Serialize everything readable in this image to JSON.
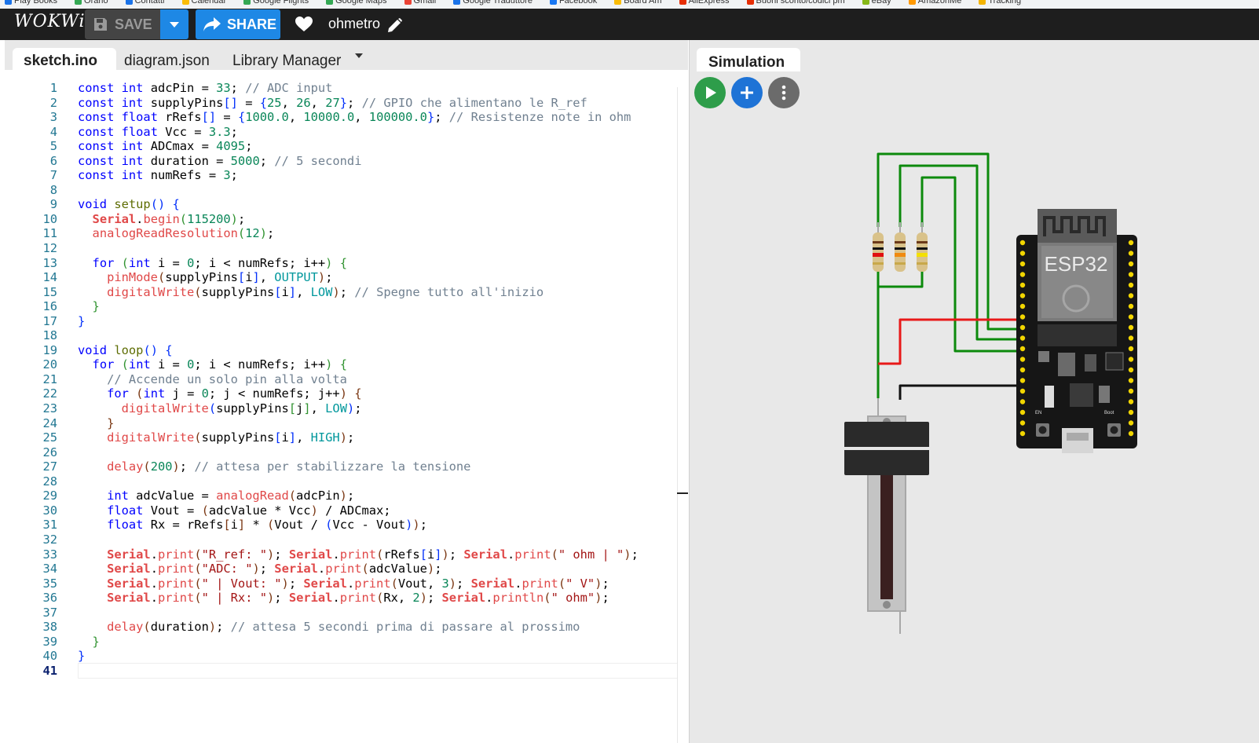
{
  "bookmarks": [
    {
      "label": "Play Books",
      "color": "#1a73e8"
    },
    {
      "label": "Orario",
      "color": "#34a853"
    },
    {
      "label": "Contatti",
      "color": "#1a73e8"
    },
    {
      "label": "Calendar",
      "color": "#fbbc04"
    },
    {
      "label": "Google Flights",
      "color": "#34a853"
    },
    {
      "label": "Google Maps",
      "color": "#34a853"
    },
    {
      "label": "Gmail",
      "color": "#ea4335"
    },
    {
      "label": "Google Traduttore",
      "color": "#1a73e8"
    },
    {
      "label": "Facebook",
      "color": "#1877f2"
    },
    {
      "label": "Board Am",
      "color": "#fbbc04"
    },
    {
      "label": "AliExpress",
      "color": "#e62e04"
    },
    {
      "label": "Buoni sconto/codici pm",
      "color": "#e62e04"
    },
    {
      "label": "eBay",
      "color": "#86b817"
    },
    {
      "label": "AmazonMe",
      "color": "#ff9900"
    },
    {
      "label": "Tracking",
      "color": "#f4b400"
    }
  ],
  "header": {
    "logo": "WOKWi",
    "save_label": "SAVE",
    "share_label": "SHARE",
    "project_name": "ohmetro"
  },
  "editor": {
    "tabs": [
      {
        "label": "sketch.ino",
        "active": true
      },
      {
        "label": "diagram.json",
        "active": false
      },
      {
        "label": "Library Manager",
        "active": false
      }
    ],
    "current_line": 41,
    "lines": [
      [
        [
          "kw",
          "const"
        ],
        [
          "t",
          " "
        ],
        [
          "kw",
          "int"
        ],
        [
          "t",
          " adcPin = "
        ],
        [
          "num",
          "33"
        ],
        [
          "t",
          "; "
        ],
        [
          "cmt",
          "// ADC input"
        ]
      ],
      [
        [
          "kw",
          "const"
        ],
        [
          "t",
          " "
        ],
        [
          "kw",
          "int"
        ],
        [
          "t",
          " supplyPins"
        ],
        [
          "br0",
          "[]"
        ],
        [
          "t",
          " = "
        ],
        [
          "br0",
          "{"
        ],
        [
          "num",
          "25"
        ],
        [
          "t",
          ", "
        ],
        [
          "num",
          "26"
        ],
        [
          "t",
          ", "
        ],
        [
          "num",
          "27"
        ],
        [
          "br0",
          "}"
        ],
        [
          "t",
          "; "
        ],
        [
          "cmt",
          "// GPIO che alimentano le R_ref"
        ]
      ],
      [
        [
          "kw",
          "const"
        ],
        [
          "t",
          " "
        ],
        [
          "kw",
          "float"
        ],
        [
          "t",
          " rRefs"
        ],
        [
          "br0",
          "[]"
        ],
        [
          "t",
          " = "
        ],
        [
          "br0",
          "{"
        ],
        [
          "num",
          "1000.0"
        ],
        [
          "t",
          ", "
        ],
        [
          "num",
          "10000.0"
        ],
        [
          "t",
          ", "
        ],
        [
          "num",
          "100000.0"
        ],
        [
          "br0",
          "}"
        ],
        [
          "t",
          "; "
        ],
        [
          "cmt",
          "// Resistenze note in ohm"
        ]
      ],
      [
        [
          "kw",
          "const"
        ],
        [
          "t",
          " "
        ],
        [
          "kw",
          "float"
        ],
        [
          "t",
          " Vcc = "
        ],
        [
          "num",
          "3.3"
        ],
        [
          "t",
          ";"
        ]
      ],
      [
        [
          "kw",
          "const"
        ],
        [
          "t",
          " "
        ],
        [
          "kw",
          "int"
        ],
        [
          "t",
          " ADCmax = "
        ],
        [
          "num",
          "4095"
        ],
        [
          "t",
          ";"
        ]
      ],
      [
        [
          "kw",
          "const"
        ],
        [
          "t",
          " "
        ],
        [
          "kw",
          "int"
        ],
        [
          "t",
          " duration = "
        ],
        [
          "num",
          "5000"
        ],
        [
          "t",
          "; "
        ],
        [
          "cmt",
          "// 5 secondi"
        ]
      ],
      [
        [
          "kw",
          "const"
        ],
        [
          "t",
          " "
        ],
        [
          "kw",
          "int"
        ],
        [
          "t",
          " numRefs = "
        ],
        [
          "num",
          "3"
        ],
        [
          "t",
          ";"
        ]
      ],
      [],
      [
        [
          "kw",
          "void"
        ],
        [
          "t",
          " "
        ],
        [
          "fns",
          "setup"
        ],
        [
          "br0",
          "()"
        ],
        [
          "t",
          " "
        ],
        [
          "br0",
          "{"
        ]
      ],
      [
        [
          "t",
          "  "
        ],
        [
          "ser",
          "Serial"
        ],
        [
          "t",
          "."
        ],
        [
          "fn",
          "begin"
        ],
        [
          "br1",
          "("
        ],
        [
          "num",
          "115200"
        ],
        [
          "br1",
          ")"
        ],
        [
          "t",
          ";"
        ]
      ],
      [
        [
          "t",
          "  "
        ],
        [
          "fn",
          "analogReadResolution"
        ],
        [
          "br1",
          "("
        ],
        [
          "num",
          "12"
        ],
        [
          "br1",
          ")"
        ],
        [
          "t",
          ";"
        ]
      ],
      [],
      [
        [
          "t",
          "  "
        ],
        [
          "kw",
          "for"
        ],
        [
          "t",
          " "
        ],
        [
          "br1",
          "("
        ],
        [
          "kw",
          "int"
        ],
        [
          "t",
          " i = "
        ],
        [
          "num",
          "0"
        ],
        [
          "t",
          "; i < numRefs; i++"
        ],
        [
          "br1",
          ")"
        ],
        [
          "t",
          " "
        ],
        [
          "br1",
          "{"
        ]
      ],
      [
        [
          "t",
          "    "
        ],
        [
          "fn",
          "pinMode"
        ],
        [
          "br2",
          "("
        ],
        [
          "t",
          "supplyPins"
        ],
        [
          "br0",
          "["
        ],
        [
          "t",
          "i"
        ],
        [
          "br0",
          "]"
        ],
        [
          "t",
          ", "
        ],
        [
          "cst",
          "OUTPUT"
        ],
        [
          "br2",
          ")"
        ],
        [
          "t",
          ";"
        ]
      ],
      [
        [
          "t",
          "    "
        ],
        [
          "fn",
          "digitalWrite"
        ],
        [
          "br2",
          "("
        ],
        [
          "t",
          "supplyPins"
        ],
        [
          "br0",
          "["
        ],
        [
          "t",
          "i"
        ],
        [
          "br0",
          "]"
        ],
        [
          "t",
          ", "
        ],
        [
          "cst",
          "LOW"
        ],
        [
          "br2",
          ")"
        ],
        [
          "t",
          "; "
        ],
        [
          "cmt",
          "// Spegne tutto all'inizio"
        ]
      ],
      [
        [
          "t",
          "  "
        ],
        [
          "br1",
          "}"
        ]
      ],
      [
        [
          "br0",
          "}"
        ]
      ],
      [],
      [
        [
          "kw",
          "void"
        ],
        [
          "t",
          " "
        ],
        [
          "fns",
          "loop"
        ],
        [
          "br0",
          "()"
        ],
        [
          "t",
          " "
        ],
        [
          "br0",
          "{"
        ]
      ],
      [
        [
          "t",
          "  "
        ],
        [
          "kw",
          "for"
        ],
        [
          "t",
          " "
        ],
        [
          "br1",
          "("
        ],
        [
          "kw",
          "int"
        ],
        [
          "t",
          " i = "
        ],
        [
          "num",
          "0"
        ],
        [
          "t",
          "; i < numRefs; i++"
        ],
        [
          "br1",
          ")"
        ],
        [
          "t",
          " "
        ],
        [
          "br1",
          "{"
        ]
      ],
      [
        [
          "t",
          "    "
        ],
        [
          "cmt",
          "// Accende un solo pin alla volta"
        ]
      ],
      [
        [
          "t",
          "    "
        ],
        [
          "kw",
          "for"
        ],
        [
          "t",
          " "
        ],
        [
          "br2",
          "("
        ],
        [
          "kw",
          "int"
        ],
        [
          "t",
          " j = "
        ],
        [
          "num",
          "0"
        ],
        [
          "t",
          "; j < numRefs; j++"
        ],
        [
          "br2",
          ")"
        ],
        [
          "t",
          " "
        ],
        [
          "br2",
          "{"
        ]
      ],
      [
        [
          "t",
          "      "
        ],
        [
          "fn",
          "digitalWrite"
        ],
        [
          "br0",
          "("
        ],
        [
          "t",
          "supplyPins"
        ],
        [
          "br1",
          "["
        ],
        [
          "t",
          "j"
        ],
        [
          "br1",
          "]"
        ],
        [
          "t",
          ", "
        ],
        [
          "cst",
          "LOW"
        ],
        [
          "br0",
          ")"
        ],
        [
          "t",
          ";"
        ]
      ],
      [
        [
          "t",
          "    "
        ],
        [
          "br2",
          "}"
        ]
      ],
      [
        [
          "t",
          "    "
        ],
        [
          "fn",
          "digitalWrite"
        ],
        [
          "br2",
          "("
        ],
        [
          "t",
          "supplyPins"
        ],
        [
          "br0",
          "["
        ],
        [
          "t",
          "i"
        ],
        [
          "br0",
          "]"
        ],
        [
          "t",
          ", "
        ],
        [
          "cst",
          "HIGH"
        ],
        [
          "br2",
          ")"
        ],
        [
          "t",
          ";"
        ]
      ],
      [],
      [
        [
          "t",
          "    "
        ],
        [
          "fn",
          "delay"
        ],
        [
          "br2",
          "("
        ],
        [
          "num",
          "200"
        ],
        [
          "br2",
          ")"
        ],
        [
          "t",
          "; "
        ],
        [
          "cmt",
          "// attesa per stabilizzare la tensione"
        ]
      ],
      [],
      [
        [
          "t",
          "    "
        ],
        [
          "kw",
          "int"
        ],
        [
          "t",
          " adcValue = "
        ],
        [
          "fn",
          "analogRead"
        ],
        [
          "br2",
          "("
        ],
        [
          "t",
          "adcPin"
        ],
        [
          "br2",
          ")"
        ],
        [
          "t",
          ";"
        ]
      ],
      [
        [
          "t",
          "    "
        ],
        [
          "kw",
          "float"
        ],
        [
          "t",
          " Vout = "
        ],
        [
          "br2",
          "("
        ],
        [
          "t",
          "adcValue * Vcc"
        ],
        [
          "br2",
          ")"
        ],
        [
          "t",
          " / ADCmax;"
        ]
      ],
      [
        [
          "t",
          "    "
        ],
        [
          "kw",
          "float"
        ],
        [
          "t",
          " Rx = rRefs"
        ],
        [
          "br2",
          "["
        ],
        [
          "t",
          "i"
        ],
        [
          "br2",
          "]"
        ],
        [
          "t",
          " * "
        ],
        [
          "br2",
          "("
        ],
        [
          "t",
          "Vout / "
        ],
        [
          "br0",
          "("
        ],
        [
          "t",
          "Vcc - Vout"
        ],
        [
          "br0",
          ")"
        ],
        [
          "br2",
          ")"
        ],
        [
          "t",
          ";"
        ]
      ],
      [],
      [
        [
          "t",
          "    "
        ],
        [
          "ser",
          "Serial"
        ],
        [
          "t",
          "."
        ],
        [
          "fn",
          "print"
        ],
        [
          "br2",
          "("
        ],
        [
          "str",
          "\"R_ref: \""
        ],
        [
          "br2",
          ")"
        ],
        [
          "t",
          "; "
        ],
        [
          "ser",
          "Serial"
        ],
        [
          "t",
          "."
        ],
        [
          "fn",
          "print"
        ],
        [
          "br2",
          "("
        ],
        [
          "t",
          "rRefs"
        ],
        [
          "br0",
          "["
        ],
        [
          "t",
          "i"
        ],
        [
          "br0",
          "]"
        ],
        [
          "br2",
          ")"
        ],
        [
          "t",
          "; "
        ],
        [
          "ser",
          "Serial"
        ],
        [
          "t",
          "."
        ],
        [
          "fn",
          "print"
        ],
        [
          "br2",
          "("
        ],
        [
          "str",
          "\" ohm | \""
        ],
        [
          "br2",
          ")"
        ],
        [
          "t",
          ";"
        ]
      ],
      [
        [
          "t",
          "    "
        ],
        [
          "ser",
          "Serial"
        ],
        [
          "t",
          "."
        ],
        [
          "fn",
          "print"
        ],
        [
          "br2",
          "("
        ],
        [
          "str",
          "\"ADC: \""
        ],
        [
          "br2",
          ")"
        ],
        [
          "t",
          "; "
        ],
        [
          "ser",
          "Serial"
        ],
        [
          "t",
          "."
        ],
        [
          "fn",
          "print"
        ],
        [
          "br2",
          "("
        ],
        [
          "t",
          "adcValue"
        ],
        [
          "br2",
          ")"
        ],
        [
          "t",
          ";"
        ]
      ],
      [
        [
          "t",
          "    "
        ],
        [
          "ser",
          "Serial"
        ],
        [
          "t",
          "."
        ],
        [
          "fn",
          "print"
        ],
        [
          "br2",
          "("
        ],
        [
          "str",
          "\" | Vout: \""
        ],
        [
          "br2",
          ")"
        ],
        [
          "t",
          "; "
        ],
        [
          "ser",
          "Serial"
        ],
        [
          "t",
          "."
        ],
        [
          "fn",
          "print"
        ],
        [
          "br2",
          "("
        ],
        [
          "t",
          "Vout, "
        ],
        [
          "num",
          "3"
        ],
        [
          "br2",
          ")"
        ],
        [
          "t",
          "; "
        ],
        [
          "ser",
          "Serial"
        ],
        [
          "t",
          "."
        ],
        [
          "fn",
          "print"
        ],
        [
          "br2",
          "("
        ],
        [
          "str",
          "\" V\""
        ],
        [
          "br2",
          ")"
        ],
        [
          "t",
          ";"
        ]
      ],
      [
        [
          "t",
          "    "
        ],
        [
          "ser",
          "Serial"
        ],
        [
          "t",
          "."
        ],
        [
          "fn",
          "print"
        ],
        [
          "br2",
          "("
        ],
        [
          "str",
          "\" | Rx: \""
        ],
        [
          "br2",
          ")"
        ],
        [
          "t",
          "; "
        ],
        [
          "ser",
          "Serial"
        ],
        [
          "t",
          "."
        ],
        [
          "fn",
          "print"
        ],
        [
          "br2",
          "("
        ],
        [
          "t",
          "Rx, "
        ],
        [
          "num",
          "2"
        ],
        [
          "br2",
          ")"
        ],
        [
          "t",
          "; "
        ],
        [
          "ser",
          "Serial"
        ],
        [
          "t",
          "."
        ],
        [
          "fn",
          "println"
        ],
        [
          "br2",
          "("
        ],
        [
          "str",
          "\" ohm\""
        ],
        [
          "br2",
          ")"
        ],
        [
          "t",
          ";"
        ]
      ],
      [],
      [
        [
          "t",
          "    "
        ],
        [
          "fn",
          "delay"
        ],
        [
          "br2",
          "("
        ],
        [
          "t",
          "duration"
        ],
        [
          "br2",
          ")"
        ],
        [
          "t",
          "; "
        ],
        [
          "cmt",
          "// attesa 5 secondi prima di passare al prossimo"
        ]
      ],
      [
        [
          "t",
          "  "
        ],
        [
          "br1",
          "}"
        ]
      ],
      [
        [
          "br0",
          "}"
        ]
      ],
      []
    ]
  },
  "simulation": {
    "tab_label": "Simulation",
    "board_label": "ESP32",
    "board_pin_labels": {
      "en": "EN",
      "boot": "Boot"
    }
  }
}
